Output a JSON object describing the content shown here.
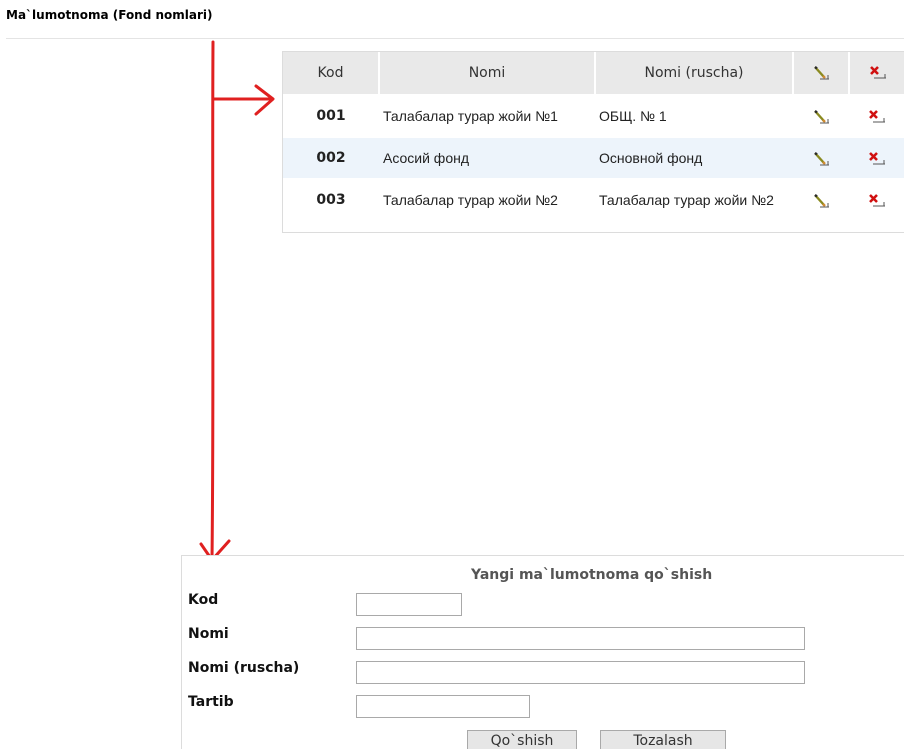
{
  "page": {
    "title": "Ma`lumotnoma (Fond nomlari)"
  },
  "table": {
    "headers": {
      "kod": "Kod",
      "nomi": "Nomi",
      "nomi_ru": "Nomi (ruscha)"
    },
    "edit_icon": "edit-pencil-icon",
    "delete_icon": "delete-x-icon",
    "rows": [
      {
        "kod": "001",
        "nomi": "Талабалар турар жойи №1",
        "nomi_ru": "ОБЩ. № 1"
      },
      {
        "kod": "002",
        "nomi": "Асосий фонд",
        "nomi_ru": "Основной фонд"
      },
      {
        "kod": "003",
        "nomi": "Талабалар турар жойи №2",
        "nomi_ru": "Талабалар турар жойи №2"
      }
    ]
  },
  "form": {
    "title": "Yangi ma`lumotnoma qo`shish",
    "kod_label": "Kod",
    "kod_value": "",
    "nomi_label": "Nomi",
    "nomi_value": "",
    "nomi_ru_label": "Nomi (ruscha)",
    "nomi_ru_value": "",
    "tartib_label": "Tartib",
    "tartib_value": "",
    "add_button": "Qo`shish",
    "clear_button": "Tozalash"
  },
  "colors": {
    "annotation_arrow": "#e02020",
    "header_bg": "#e9e9e9",
    "alt_row_bg": "#edf4fb"
  }
}
